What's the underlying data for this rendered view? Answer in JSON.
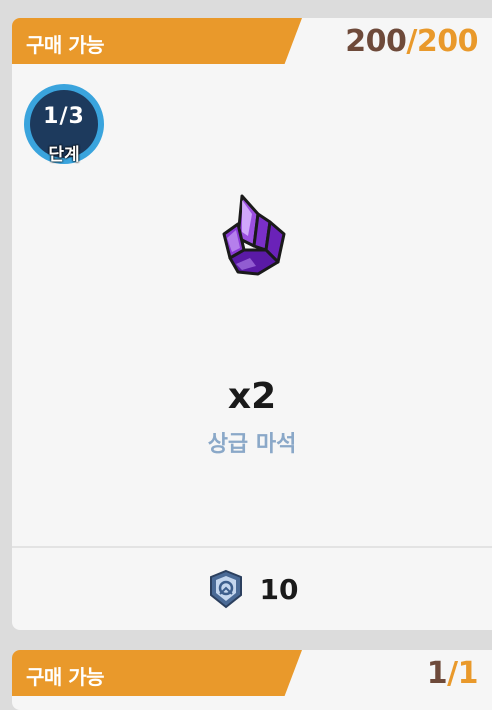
{
  "cards": [
    {
      "status_label": "구매 가능",
      "count_current": "200",
      "count_separator": "/",
      "count_max": "200",
      "stage_fraction": "1/3",
      "stage_label": "단계",
      "item_icon": "purple-crystal-icon",
      "item_quantity": "x2",
      "item_name": "상급 마석",
      "price_icon": "shield-coin-icon",
      "price_value": "10"
    },
    {
      "status_label": "구매 가능",
      "count_current": "1",
      "count_separator": "/",
      "count_max": "1"
    }
  ],
  "colors": {
    "tag_orange": "#e9992b",
    "count_current": "#6e4a3a",
    "item_name": "#8aa8c8",
    "stage_ring": "#3aa4dd",
    "stage_fill": "#1d3a5d"
  }
}
